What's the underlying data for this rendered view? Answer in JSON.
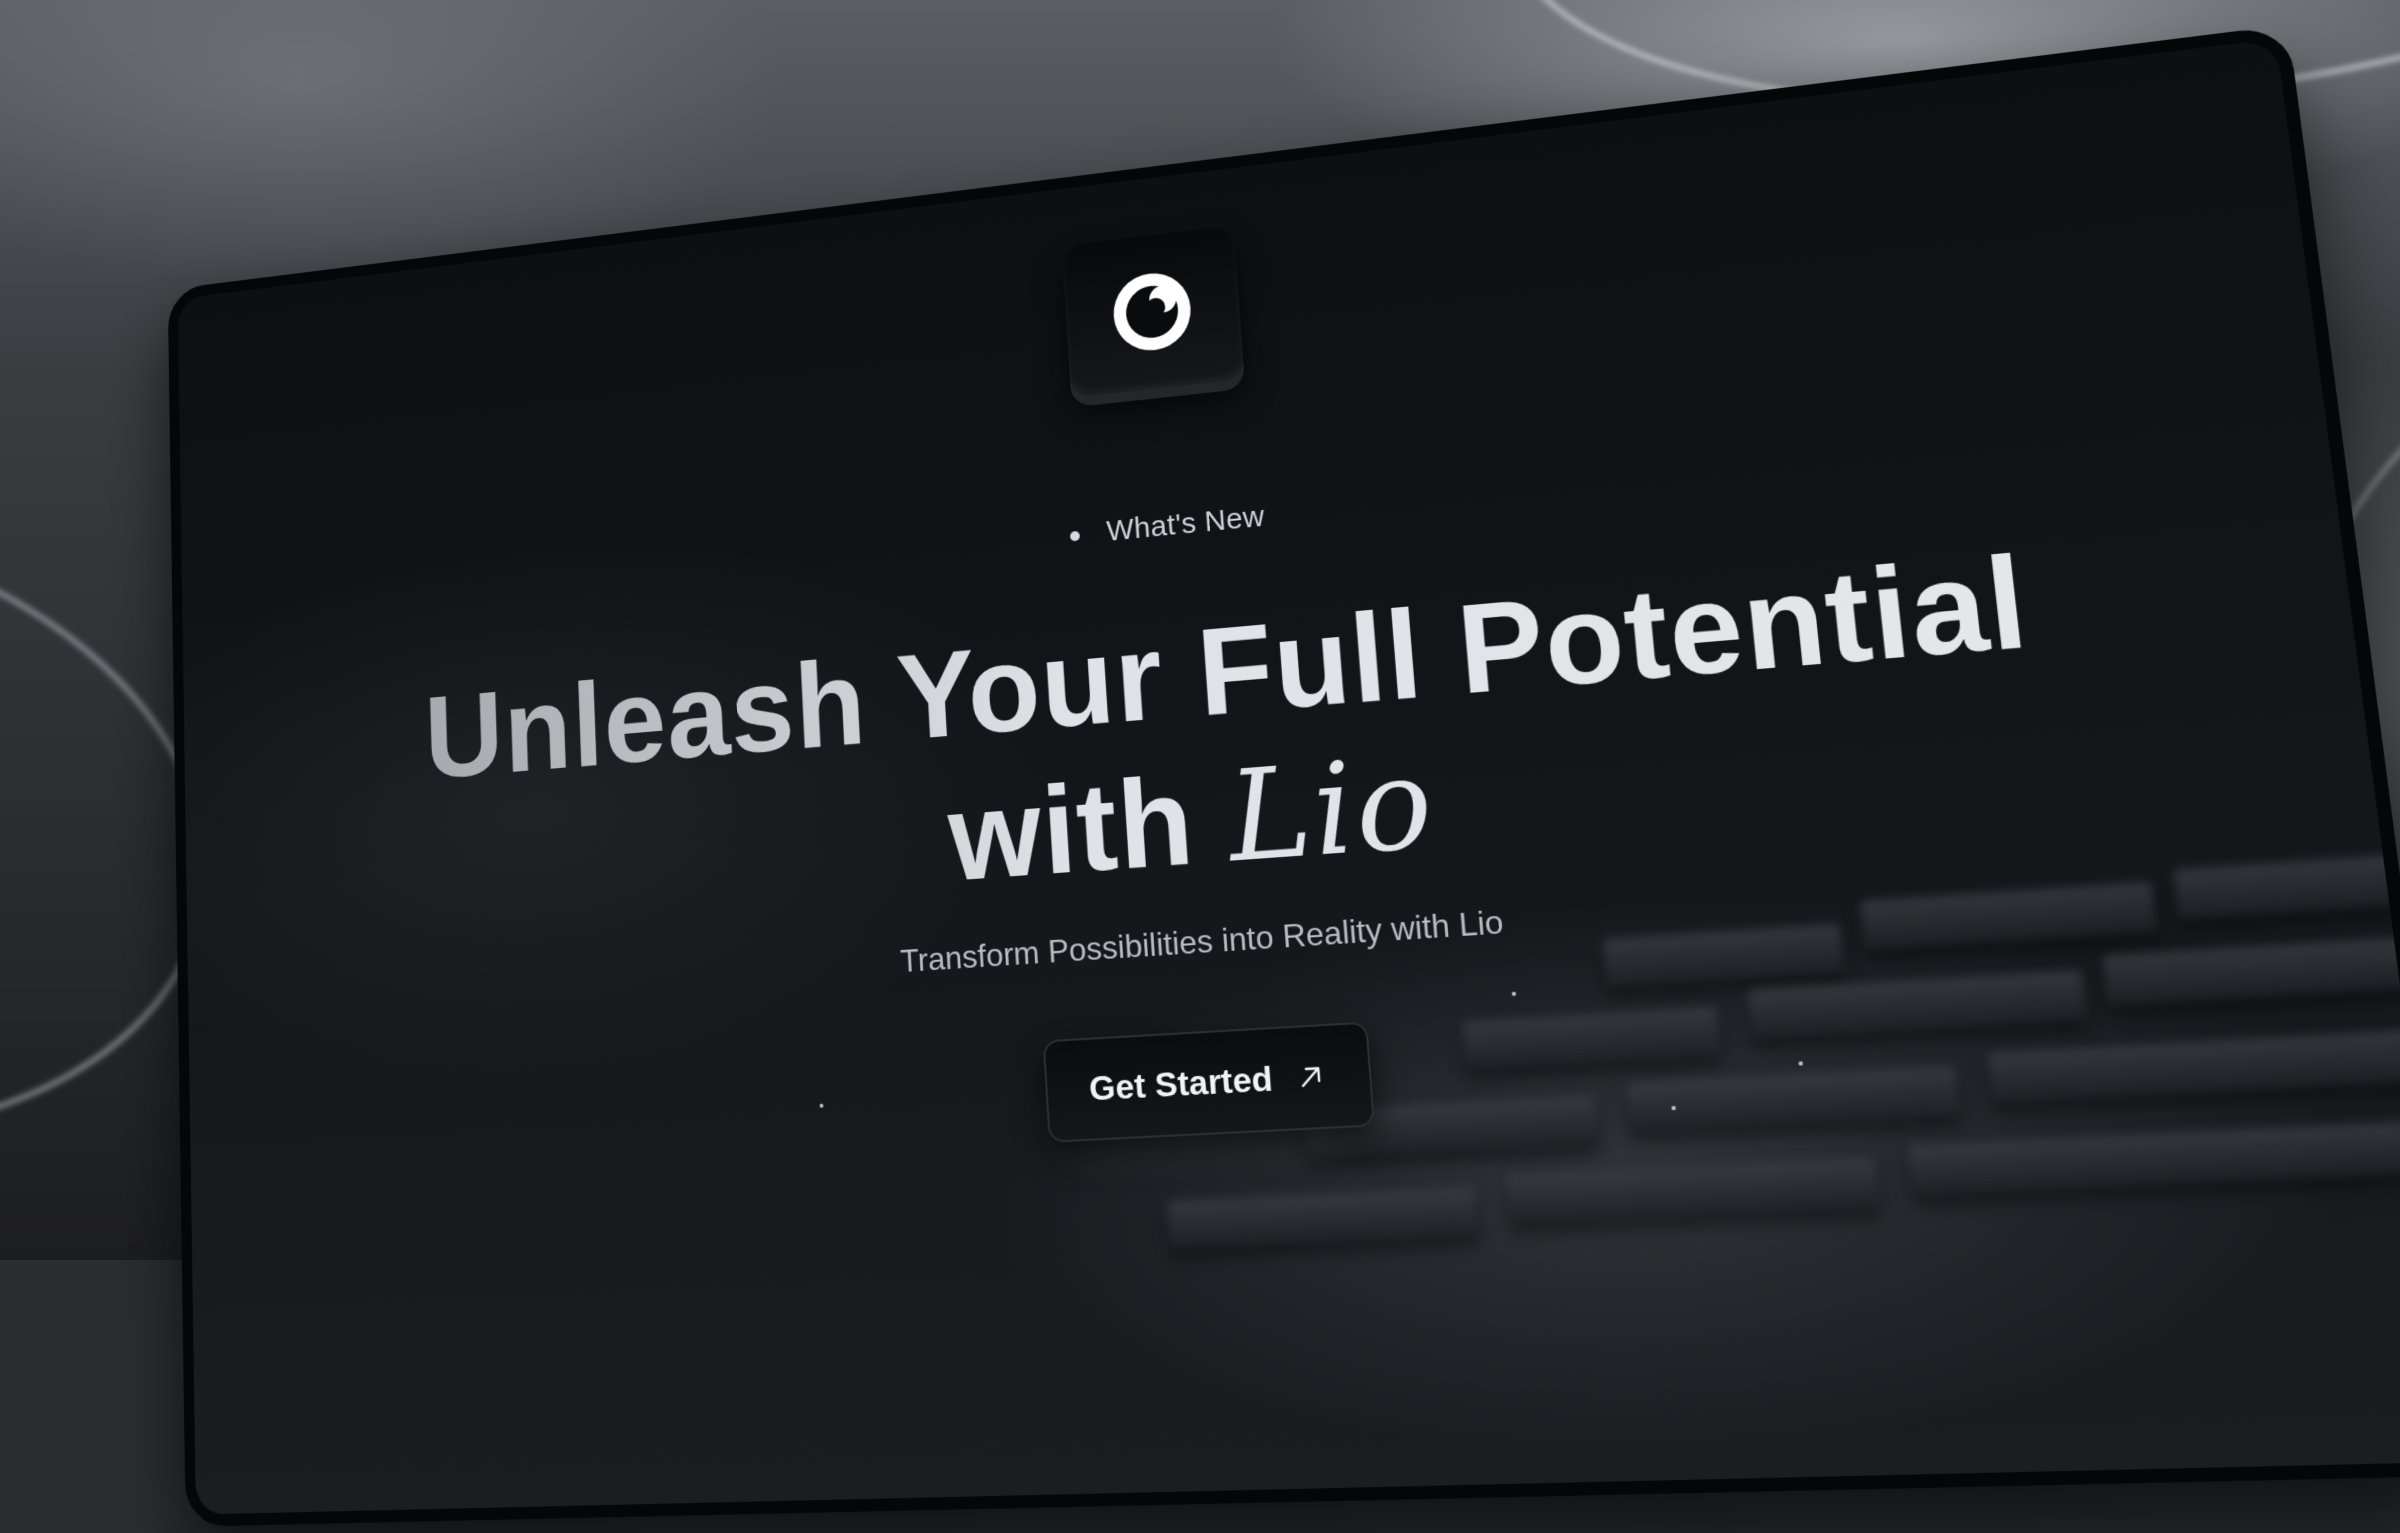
{
  "hero": {
    "badge_label": "What's New",
    "headline_line1": "Unleash Your Full Potential",
    "headline_line2_prefix": "with",
    "headline_brand": "Lio",
    "subtitle": "Transform Possibilities into Reality with Lio",
    "cta_label": "Get Started"
  },
  "icons": {
    "logo": "lio-logo-icon",
    "cta_arrow": "arrow-up-right-icon",
    "badge_dot": "dot-icon"
  },
  "colors": {
    "window_bg": "#0d0f12",
    "frame": "#050607",
    "text_primary": "#e6e8eb",
    "text_muted": "#b9bcc1"
  }
}
